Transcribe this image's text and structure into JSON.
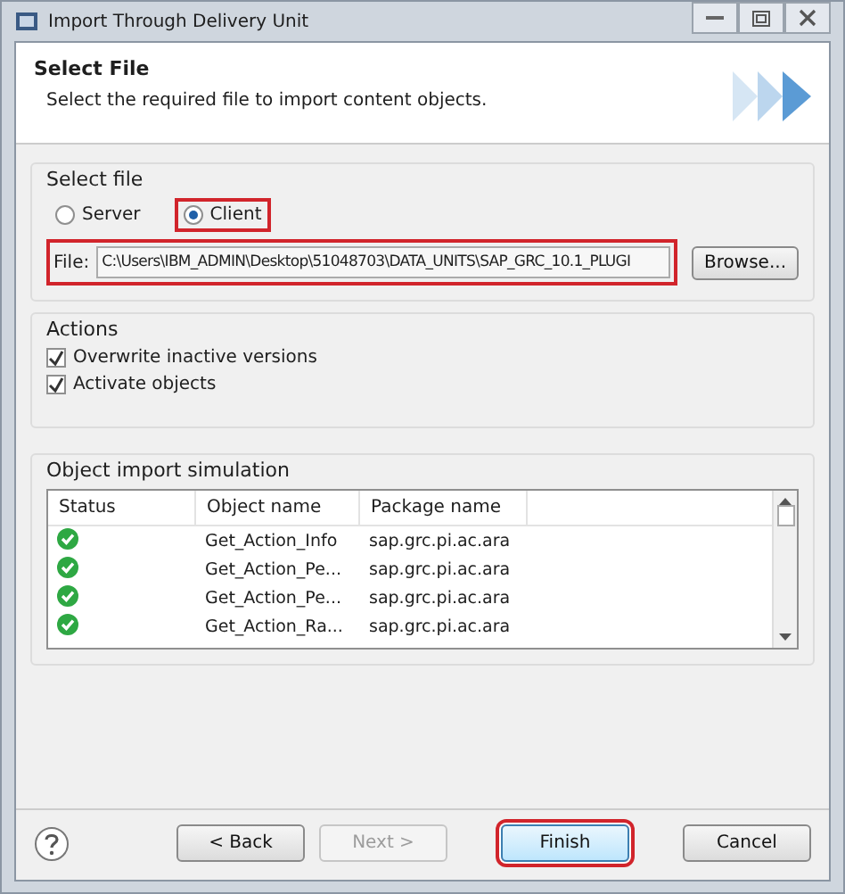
{
  "window": {
    "title": "Import Through Delivery Unit"
  },
  "header": {
    "title": "Select File",
    "description": "Select the required file to import content objects."
  },
  "select_file": {
    "label": "Select file",
    "options": [
      {
        "label": "Server",
        "selected": false,
        "highlighted": false
      },
      {
        "label": "Client",
        "selected": true,
        "highlighted": true
      }
    ],
    "file": {
      "label": "File:",
      "value": "C:\\Users\\IBM_ADMIN\\Desktop\\51048703\\DATA_UNITS\\SAP_GRC_10.1_PLUGI",
      "highlighted": true
    },
    "browse": "Browse..."
  },
  "actions": {
    "label": "Actions",
    "items": [
      {
        "label": "Overwrite inactive versions",
        "checked": true
      },
      {
        "label": "Activate objects",
        "checked": true
      }
    ]
  },
  "simulation": {
    "label": "Object import simulation",
    "columns": [
      "Status",
      "Object name",
      "Package name"
    ],
    "rows": [
      {
        "kind": "success",
        "object": "Get_Action_Info",
        "package": "sap.grc.pi.ac.ara"
      },
      {
        "kind": "success",
        "object": "Get_Action_Pe...",
        "package": "sap.grc.pi.ac.ara"
      },
      {
        "kind": "success",
        "object": "Get_Action_Pe...",
        "package": "sap.grc.pi.ac.ara"
      },
      {
        "kind": "success",
        "object": "Get_Action_Ra...",
        "package": "sap.grc.pi.ac.ara"
      }
    ]
  },
  "buttons": [
    {
      "label": "< Back",
      "disabled": false,
      "default": false,
      "highlighted": false
    },
    {
      "label": "Next >",
      "disabled": true,
      "default": false,
      "highlighted": false
    },
    {
      "label": "Finish",
      "disabled": false,
      "default": true,
      "highlighted": true
    },
    {
      "label": "Cancel",
      "disabled": false,
      "default": false,
      "highlighted": false
    }
  ]
}
